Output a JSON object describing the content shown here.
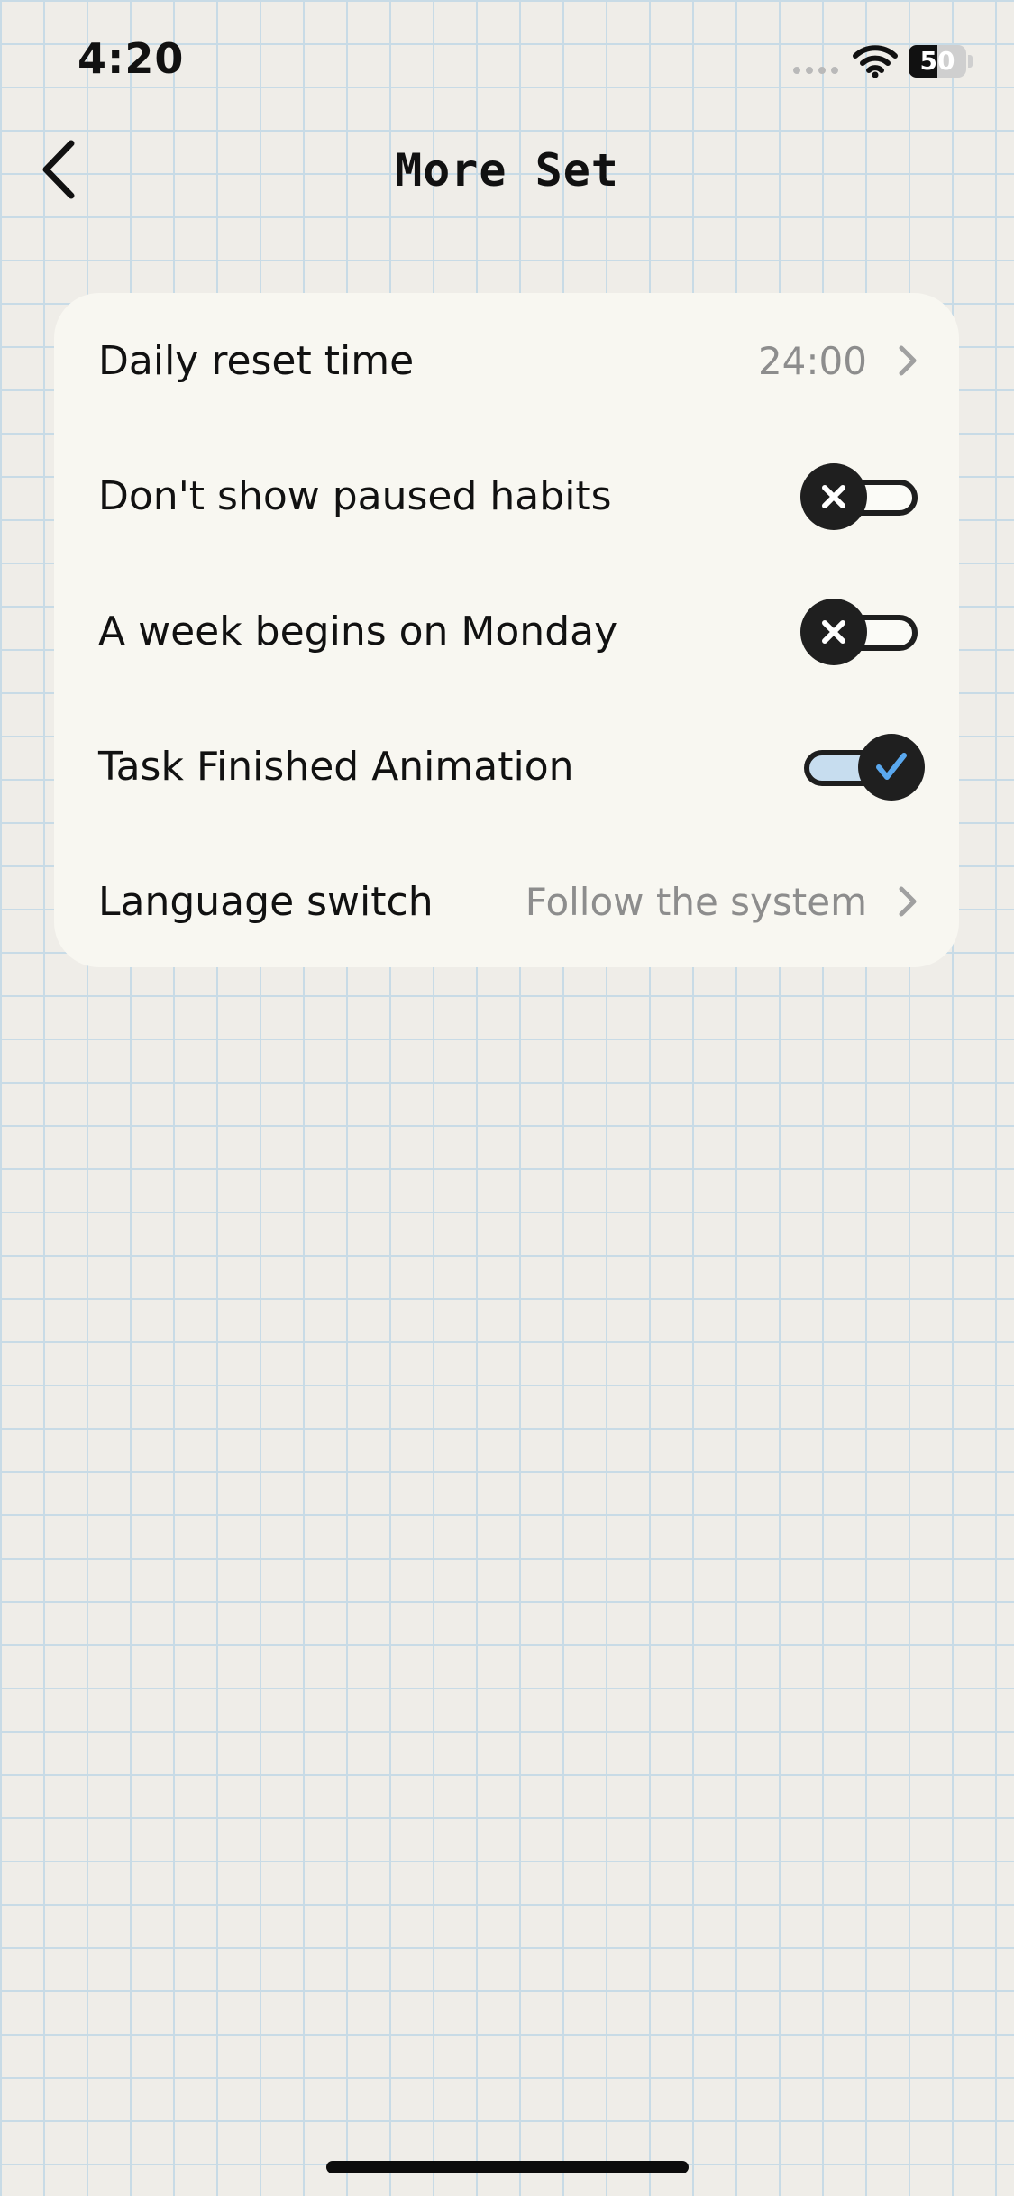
{
  "status_bar": {
    "time": "4:20",
    "battery": "50",
    "battery_level": 0.5
  },
  "nav": {
    "title": "More Set"
  },
  "settings": {
    "daily_reset": {
      "label": "Daily reset time",
      "value": "24:00"
    },
    "paused_habits": {
      "label": "Don't show paused habits",
      "enabled": false
    },
    "week_monday": {
      "label": "A week begins on Monday",
      "enabled": false
    },
    "task_animation": {
      "label": "Task Finished Animation",
      "enabled": true
    },
    "language": {
      "label": "Language switch",
      "value": "Follow the system"
    }
  },
  "colors": {
    "background": "#efede8",
    "grid_line": "#c8dbe6",
    "card": "#f8f7f1",
    "toggle_on_track": "#c7ddef",
    "check_accent": "#5aa8ee",
    "secondary_text": "#8d8d8d"
  },
  "icons": {
    "back": "chevron-left-icon",
    "row_arrow": "chevron-right-icon",
    "toggle_off": "x-icon",
    "toggle_on": "check-icon",
    "wifi": "wifi-icon"
  }
}
